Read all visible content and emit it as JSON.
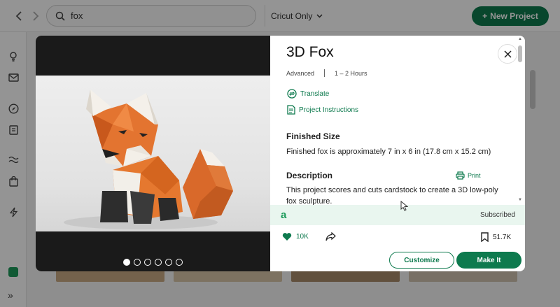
{
  "header": {
    "search": {
      "value": "fox",
      "placeholder": ""
    },
    "filter_label": "Cricut Only",
    "new_project_label": "New Project"
  },
  "sidebar": {
    "icons": [
      "lightbulb-icon",
      "mail-icon",
      "compass-icon",
      "clipboard-icon",
      "waves-icon",
      "shopping-bag-icon",
      "lightning-icon",
      "chat-icon",
      "expand-icon"
    ]
  },
  "modal": {
    "title": "3D Fox",
    "difficulty": "Advanced",
    "duration": "1 – 2 Hours",
    "links": {
      "translate": "Translate",
      "instructions": "Project Instructions",
      "print": "Print"
    },
    "finished_size": {
      "heading": "Finished Size",
      "text": "Finished fox is approximately 7 in x 6 in (17.8 cm x 15.2 cm)"
    },
    "description": {
      "heading": "Description",
      "text": "This project scores and cuts cardstock to create a 3D low-poly fox sculpture."
    },
    "subscription": {
      "logo": "a",
      "label": "Subscribed"
    },
    "stats": {
      "likes": "10K",
      "saves": "51.7K"
    },
    "carousel": {
      "count": 6,
      "active": 0
    },
    "buttons": {
      "customize": "Customize",
      "make_it": "Make It"
    },
    "colors": {
      "accent": "#0e7a4e",
      "subscribed_bg": "#e9f6ef"
    }
  }
}
